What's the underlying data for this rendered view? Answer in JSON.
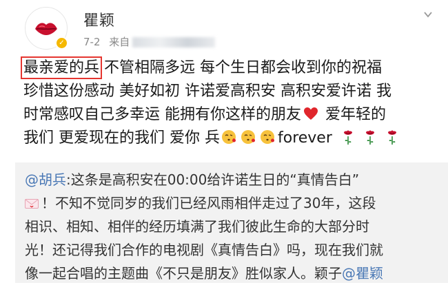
{
  "post": {
    "author_name": "瞿颖",
    "date": "7-2",
    "source_prefix": "来自",
    "chevron_icon": "chevron-down-icon",
    "avatar_icon": "red-lips-icon",
    "verified_icon": "verified-v-icon",
    "text_highlight": "最亲爱的兵",
    "line1_rest": "不管相隔多远 每个生日都会收到你的祝福",
    "line2": "珍惜这份感动 美好如初 许诺爱高积安 高积安爱许诺 我",
    "line3_before_heart": "时常感叹自己多幸运 能拥有你这样的朋友",
    "line3_after_heart": "爱年轻的",
    "line4_text": "我们 更爱现在的我们 爱你 兵",
    "line4_forever": "forever",
    "emoji_icons": [
      "blowing-kiss-emoji",
      "heart-icon",
      "rose-icon"
    ],
    "highlight_color": "#e5352f"
  },
  "repost": {
    "mention_user": "@胡兵",
    "line1_rest": ":这条是高积安在00:00给许诺生日的“真情告白”",
    "line2": "！不知不觉同岁的我们已经风雨相伴走过了30年，这段",
    "line3": "相识、相知、相伴的经历填满了我们彼此生命的大部分时",
    "line4": "光！还记得我们合作的电视剧《真情告白》吗，现在我们就",
    "line5_before": "像一起合唱的主题曲《不只是朋友》胜似家人。颖子",
    "line5_mention": "@瞿颖",
    "link_color": "#4a78b5",
    "background": "#f2f2f2"
  }
}
